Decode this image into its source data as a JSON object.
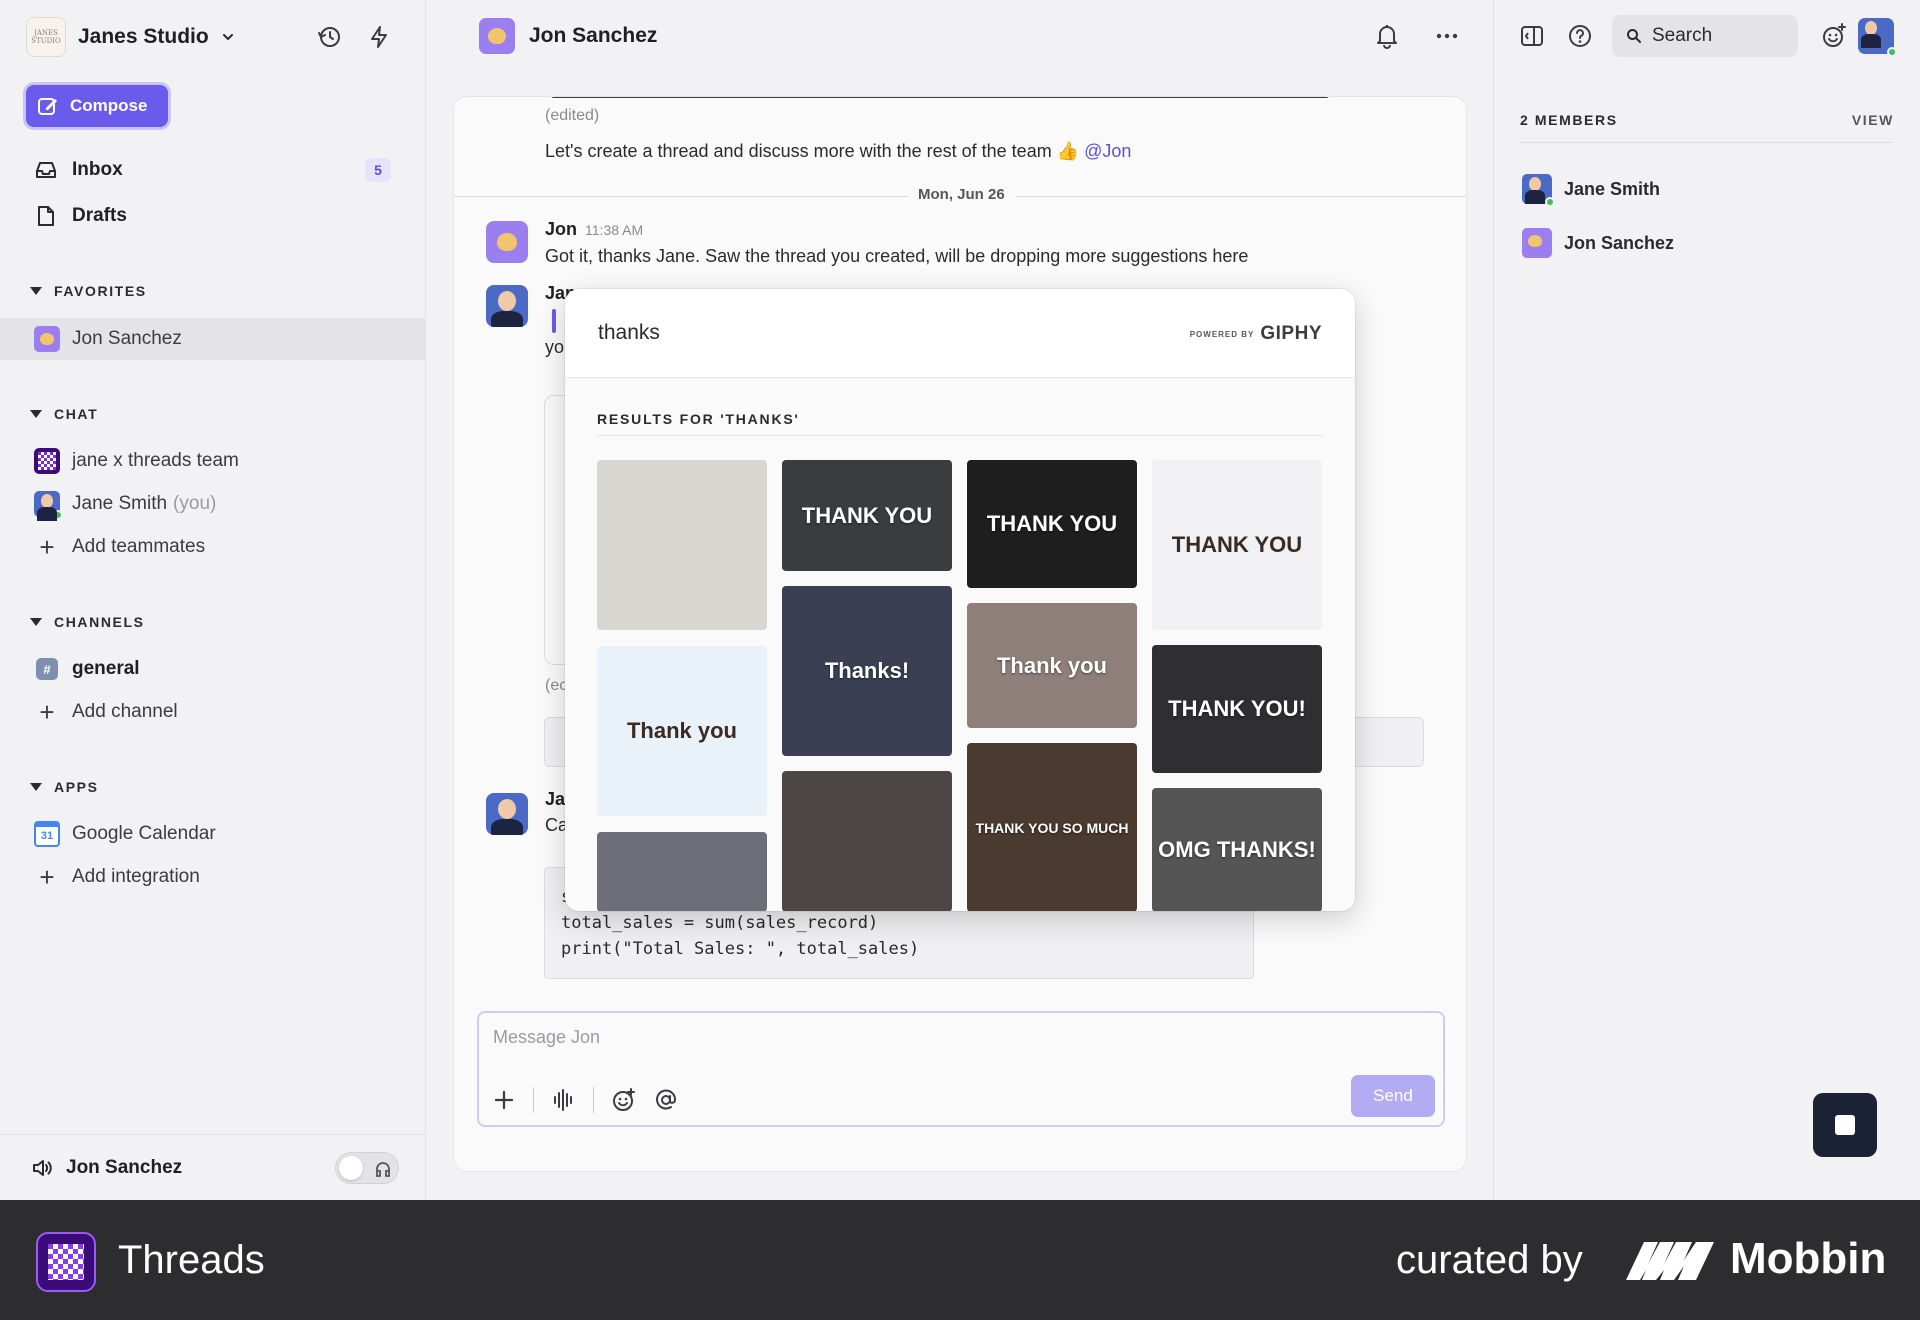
{
  "workspace": {
    "name": "Janes Studio",
    "logo_text": "JANES STUDIO"
  },
  "sidebar": {
    "compose_label": "Compose",
    "nav": [
      {
        "label": "Inbox",
        "badge": "5"
      },
      {
        "label": "Drafts"
      }
    ],
    "sections": {
      "favorites": "FAVORITES",
      "chat": "CHAT",
      "channels": "CHANNELS",
      "apps": "APPS"
    },
    "favorites": [
      {
        "label": "Jon Sanchez"
      }
    ],
    "chat": [
      {
        "label": "jane x threads team"
      },
      {
        "label": "Jane Smith",
        "suffix": "(you)"
      },
      {
        "label": "Add teammates"
      }
    ],
    "channels": [
      {
        "label": "general"
      },
      {
        "label": "Add channel"
      }
    ],
    "apps": [
      {
        "label": "Google Calendar",
        "icon_text": "31"
      },
      {
        "label": "Add integration"
      }
    ],
    "footer": {
      "label": "Jon Sanchez"
    }
  },
  "header": {
    "title": "Jon Sanchez"
  },
  "messages": {
    "edited_1": "(edited)",
    "msg_1": "Let's create a thread and discuss more with the rest of the team 👍",
    "mention": "@Jon",
    "date_divider": "Mon, Jun 26",
    "jon_name": "Jon",
    "jon_time": "11:38 AM",
    "jon_text": "Got it, thanks Jane. Saw the thread you created, will be dropping more suggestions here",
    "jane_partial": "Jan",
    "jane_text_partial": "yo",
    "edited_partial": "(ec",
    "jane2_partial": "Ja",
    "jane2_text_partial": "Ca",
    "code_lines": "s\ntotal_sales = sum(sales_record)\nprint(\"Total Sales: \", total_sales)"
  },
  "composer": {
    "placeholder": "Message Jon",
    "send_label": "Send"
  },
  "right_panel": {
    "search_label": "Search",
    "members_title": "2 MEMBERS",
    "view_label": "VIEW",
    "members": [
      {
        "name": "Jane Smith"
      },
      {
        "name": "Jon Sanchez"
      }
    ]
  },
  "giphy": {
    "query": "thanks",
    "powered_by": "POWERED BY",
    "brand": "GIPHY",
    "results_title": "RESULTS FOR 'THANKS'",
    "gifs": [
      {
        "text": "",
        "bg": "#d9d6d2"
      },
      {
        "text": "THANK YOU",
        "bg": "#3a3d40"
      },
      {
        "text": "THANK YOU",
        "bg": "#1e1e1e"
      },
      {
        "text": "THANK YOU",
        "bg": "#f1f0f5"
      },
      {
        "text": "Thanks!",
        "bg": "#3a3f53"
      },
      {
        "text": "Thank you",
        "bg": "#e9f2f8"
      },
      {
        "text": "Thank you",
        "bg": "#8f7f7a"
      },
      {
        "text": "THANK YOU!",
        "bg": "#2f2f33"
      },
      {
        "text": "",
        "bg": "#6c6f78"
      },
      {
        "text": "",
        "bg": "#4c4745"
      },
      {
        "text": "THANK YOU SO MUCH",
        "bg": "#4a3a30"
      },
      {
        "text": "OMG THANKS!",
        "bg": "#555555"
      }
    ]
  },
  "brand_bar": {
    "app_name": "Threads",
    "curated": "curated by",
    "brand": "Mobbin"
  },
  "colors": {
    "accent": "#6a5bea",
    "online": "#3fbf5a",
    "bottom_bar": "#2d2d2f"
  }
}
